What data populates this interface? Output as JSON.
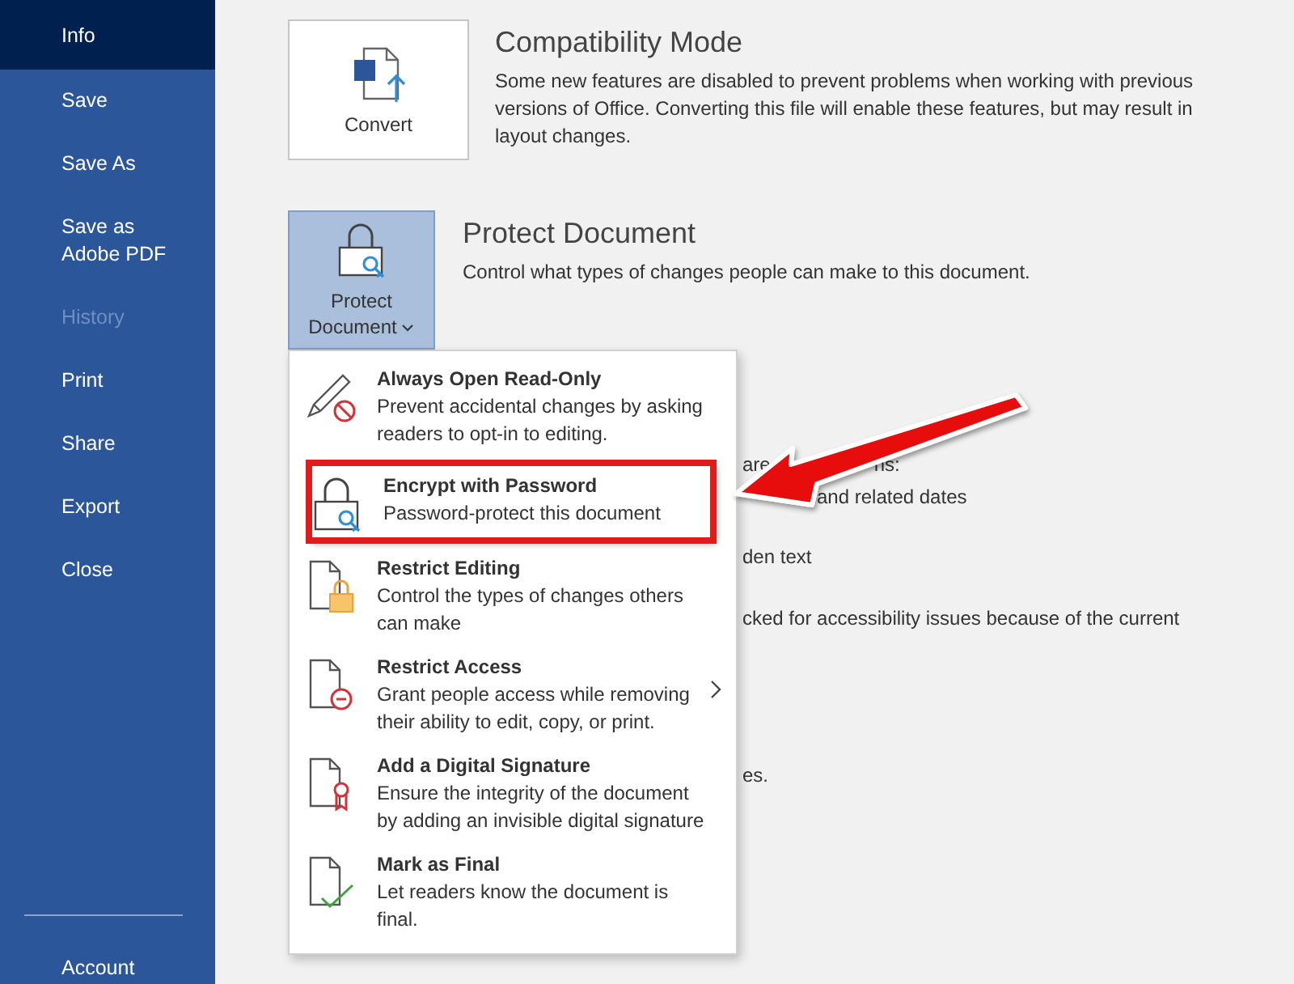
{
  "sidebar": {
    "items": [
      {
        "label": "Info",
        "selected": true,
        "disabled": false
      },
      {
        "label": "Save",
        "selected": false,
        "disabled": false
      },
      {
        "label": "Save As",
        "selected": false,
        "disabled": false
      },
      {
        "label": "Save as Adobe PDF",
        "selected": false,
        "disabled": false
      },
      {
        "label": "History",
        "selected": false,
        "disabled": true
      },
      {
        "label": "Print",
        "selected": false,
        "disabled": false
      },
      {
        "label": "Share",
        "selected": false,
        "disabled": false
      },
      {
        "label": "Export",
        "selected": false,
        "disabled": false
      },
      {
        "label": "Close",
        "selected": false,
        "disabled": false
      }
    ],
    "footer_items": [
      {
        "label": "Account"
      }
    ]
  },
  "sections": [
    {
      "kind": "convert",
      "button": "Convert",
      "title": "Compatibility Mode",
      "description": "Some new features are disabled to prevent problems when working with previous versions of Office. Converting this file will enable these features, but may result in layout changes."
    },
    {
      "kind": "protect",
      "button": "Protect Document",
      "title": "Protect Document",
      "description": "Control what types of changes people can make to this document.",
      "expanded": true
    }
  ],
  "hidden_text": [
    {
      "parts": [
        "are",
        "ns:"
      ]
    },
    {
      "parts": [
        "and related dates"
      ]
    },
    {
      "parts": [
        "den text"
      ]
    },
    {
      "parts": [
        "cked for accessibility issues because of the current"
      ]
    },
    {
      "parts": [
        "es."
      ]
    }
  ],
  "protect_menu": {
    "items": [
      {
        "kind": "read-only",
        "title": "Always Open Read-Only",
        "description": "Prevent accidental changes by asking readers to opt-in to editing.",
        "submenu": false,
        "highlighted": false
      },
      {
        "kind": "encrypt",
        "title": "Encrypt with Password",
        "description": "Password-protect this document",
        "submenu": false,
        "highlighted": true
      },
      {
        "kind": "restrict-editing",
        "title": "Restrict Editing",
        "description": "Control the types of changes others can make",
        "submenu": false,
        "highlighted": false
      },
      {
        "kind": "restrict-access",
        "title": "Restrict Access",
        "description": "Grant people access while removing their ability to edit, copy, or print.",
        "submenu": true,
        "highlighted": false
      },
      {
        "kind": "signature",
        "title": "Add a Digital Signature",
        "description": "Ensure the integrity of the document by adding an invisible digital signature",
        "submenu": false,
        "highlighted": false
      },
      {
        "kind": "final",
        "title": "Mark as Final",
        "description": "Let readers know the document is final.",
        "submenu": false,
        "highlighted": false
      }
    ]
  },
  "annotation": {
    "arrow": true
  }
}
